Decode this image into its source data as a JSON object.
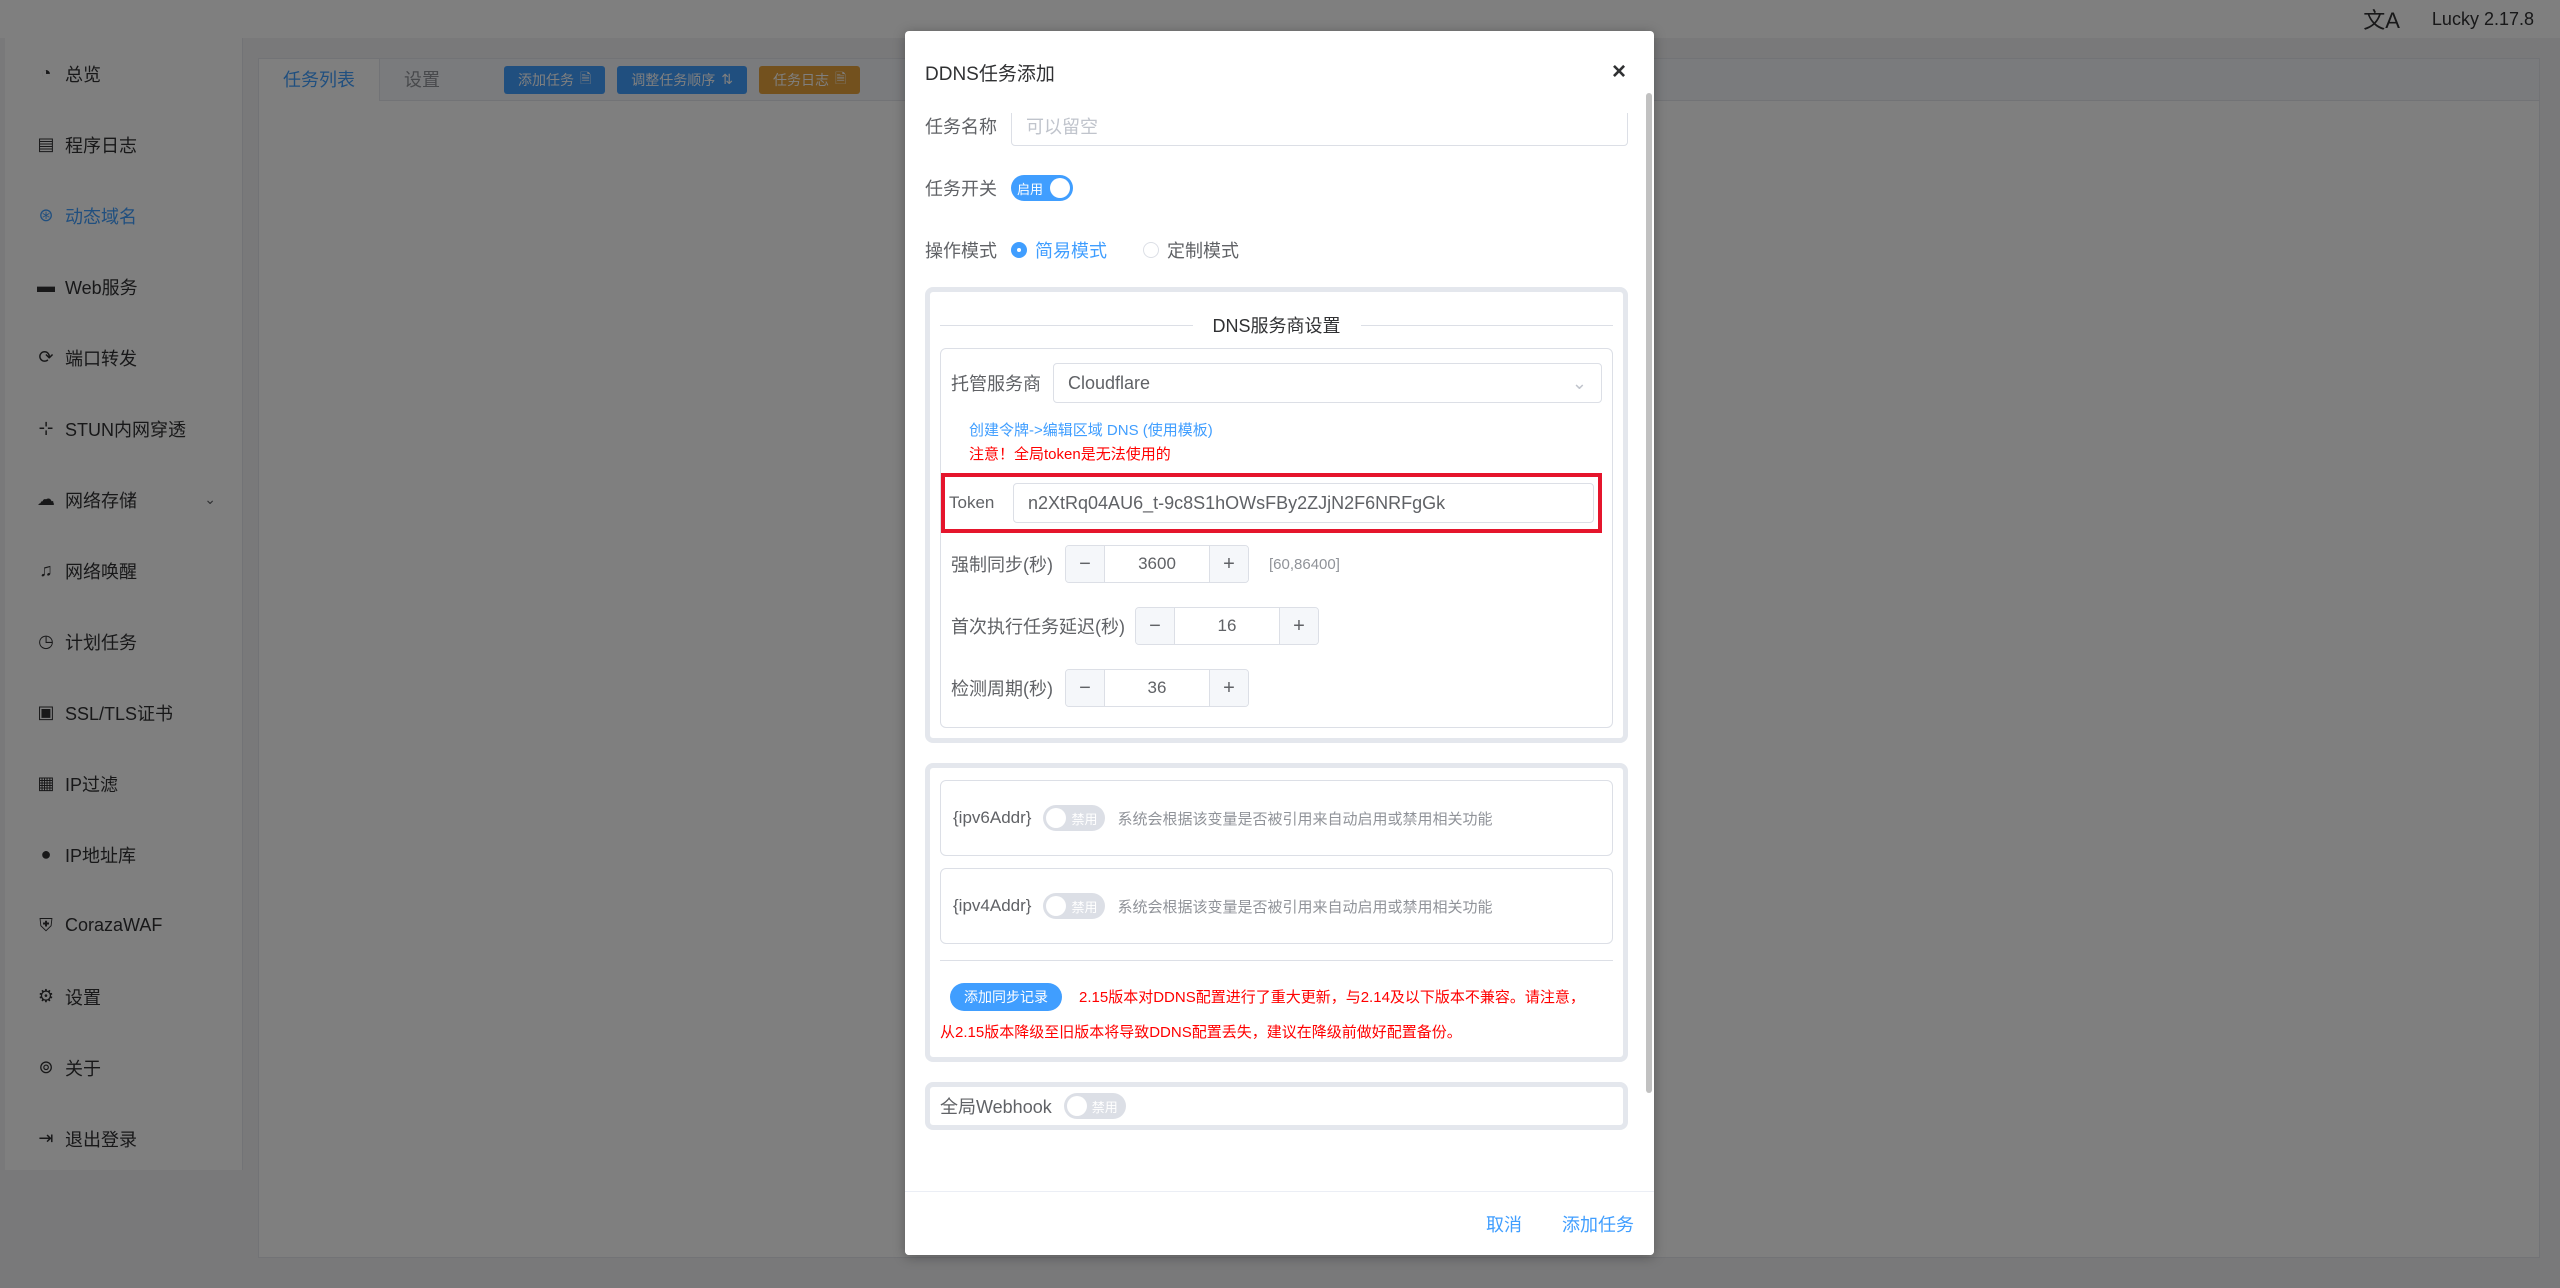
{
  "topbar": {
    "lang_icon": "文A",
    "version": "Lucky 2.17.8"
  },
  "sidebar": {
    "items": [
      {
        "label": "总览",
        "icon": "dashboard-icon",
        "glyph": "◔"
      },
      {
        "label": "程序日志",
        "icon": "log-icon",
        "glyph": "▤"
      },
      {
        "label": "动态域名",
        "icon": "ddns-icon",
        "glyph": "⊛"
      },
      {
        "label": "Web服务",
        "icon": "web-icon",
        "glyph": "▬"
      },
      {
        "label": "端口转发",
        "icon": "port-forward-icon",
        "glyph": "⟳"
      },
      {
        "label": "STUN内网穿透",
        "icon": "stun-icon",
        "glyph": "⊹"
      },
      {
        "label": "网络存储",
        "icon": "cloud-storage-icon",
        "glyph": "☁"
      },
      {
        "label": "网络唤醒",
        "icon": "bell-icon",
        "glyph": "♫"
      },
      {
        "label": "计划任务",
        "icon": "clock-icon",
        "glyph": "◷"
      },
      {
        "label": "SSL/TLS证书",
        "icon": "certificate-icon",
        "glyph": "▣"
      },
      {
        "label": "IP过滤",
        "icon": "filter-icon",
        "glyph": "▦"
      },
      {
        "label": "IP地址库",
        "icon": "user-icon",
        "glyph": "●"
      },
      {
        "label": "CorazaWAF",
        "icon": "shield-icon",
        "glyph": "⛨"
      },
      {
        "label": "设置",
        "icon": "gear-icon",
        "glyph": "⚙"
      },
      {
        "label": "关于",
        "icon": "about-icon",
        "glyph": "⊚"
      },
      {
        "label": "退出登录",
        "icon": "logout-icon",
        "glyph": "⇥"
      }
    ],
    "chevron": "⌄"
  },
  "tabs": {
    "task_list": "任务列表",
    "settings": "设置",
    "btn_add": "添加任务",
    "btn_order": "调整任务顺序",
    "btn_log": "任务日志"
  },
  "dialog": {
    "title": "DDNS任务添加",
    "close": "×",
    "task_name_label": "任务名称",
    "task_name_placeholder": "可以留空",
    "task_switch_label": "任务开关",
    "task_switch_text": "启用",
    "mode_label": "操作模式",
    "mode_simple": "简易模式",
    "mode_custom": "定制模式",
    "dns_section_title": "DNS服务商设置",
    "provider_label": "托管服务商",
    "provider_value": "Cloudflare",
    "create_token_link": "创建令牌->编辑区域 DNS (使用模板)",
    "token_warning": "注意！全局token是无法使用的",
    "token_label": "Token",
    "token_value": "n2XtRq04AU6_t-9c8S1hOWsFBy2ZJjN2F6NRFgGk",
    "force_sync_label": "强制同步(秒)",
    "force_sync_value": "3600",
    "force_sync_hint": "[60,86400]",
    "first_delay_label": "首次执行任务延迟(秒)",
    "first_delay_value": "16",
    "check_period_label": "检测周期(秒)",
    "check_period_value": "36",
    "ipv6_var": "{ipv6Addr}",
    "ipv4_var": "{ipv4Addr}",
    "disabled_text": "禁用",
    "var_desc": "系统会根据该变量是否被引用来自动启用或禁用相关功能",
    "add_sync_btn": "添加同步记录",
    "version_warning_1": "2.15版本对DDNS配置进行了重大更新，与2.14及以下版本不兼容。请注意，",
    "version_warning_2": "从2.15版本降级至旧版本将导致DDNS配置丢失，建议在降级前做好配置备份。",
    "webhook_label": "全局Webhook",
    "cancel": "取消",
    "confirm": "添加任务"
  },
  "colors": {
    "accent": "#409eff",
    "warning": "#ff0000",
    "highlight_border": "#e5152c",
    "orange": "#e6a23c"
  }
}
